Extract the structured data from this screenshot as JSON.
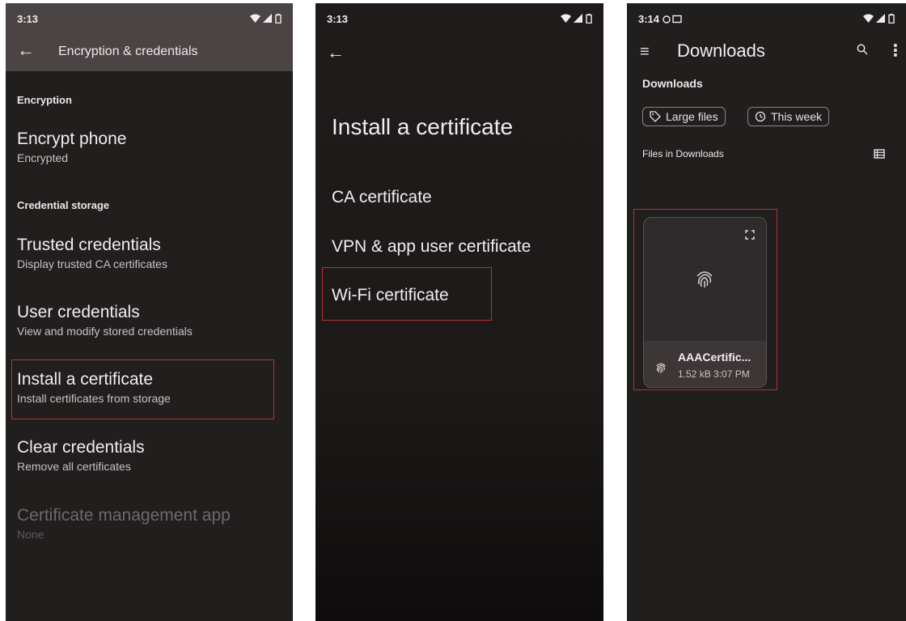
{
  "panel1": {
    "status_time": "3:13",
    "title": "Encryption & credentials",
    "sections": {
      "encryption": "Encryption",
      "credential_storage": "Credential storage"
    },
    "items": [
      {
        "title": "Encrypt phone",
        "subtitle": "Encrypted"
      },
      {
        "title": "Trusted credentials",
        "subtitle": "Display trusted CA certificates"
      },
      {
        "title": "User credentials",
        "subtitle": "View and modify stored credentials"
      },
      {
        "title": "Install a certificate",
        "subtitle": "Install certificates from storage"
      },
      {
        "title": "Clear credentials",
        "subtitle": "Remove all certificates"
      },
      {
        "title": "Certificate management app",
        "subtitle": "None"
      }
    ]
  },
  "panel2": {
    "status_time": "3:13",
    "title": "Install a certificate",
    "options": [
      "CA certificate",
      "VPN & app user certificate",
      "Wi-Fi certificate"
    ]
  },
  "panel3": {
    "status_time": "3:14",
    "app_title": "Downloads",
    "breadcrumb": "Downloads",
    "chips": [
      "Large files",
      "This week"
    ],
    "files_label": "Files in Downloads",
    "file": {
      "name": "AAACertific...",
      "meta": "1.52 kB 3:07 PM"
    }
  },
  "colors": {
    "background": "#211e1e",
    "appbar": "#4a4444",
    "highlight": "#b8312f",
    "text": "#f2ecee"
  }
}
